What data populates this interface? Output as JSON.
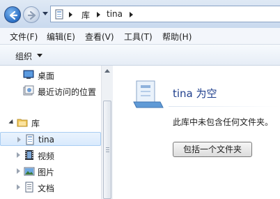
{
  "address_bar": {
    "breadcrumbs": [
      "库",
      "tina"
    ]
  },
  "menu": {
    "items": [
      "文件(F)",
      "编辑(E)",
      "查看(V)",
      "工具(T)",
      "帮助(H)"
    ]
  },
  "command_bar": {
    "organize_label": "组织"
  },
  "nav_pane": {
    "favorites": [
      {
        "label": "桌面",
        "icon": "desktop-icon"
      },
      {
        "label": "最近访问的位置",
        "icon": "recent-places-icon"
      }
    ],
    "libraries": {
      "label": "库",
      "icon": "libraries-icon",
      "items": [
        {
          "label": "tina",
          "icon": "library-icon",
          "selected": true
        },
        {
          "label": "视频",
          "icon": "videos-icon"
        },
        {
          "label": "图片",
          "icon": "pictures-icon"
        },
        {
          "label": "文档",
          "icon": "documents-icon"
        }
      ]
    }
  },
  "content": {
    "title": "tina 为空",
    "message": "此库中未包含任何文件夹。",
    "include_button": "包括一个文件夹"
  },
  "colors": {
    "title_blue": "#1e3e8c",
    "selection": "#d9eafd"
  }
}
